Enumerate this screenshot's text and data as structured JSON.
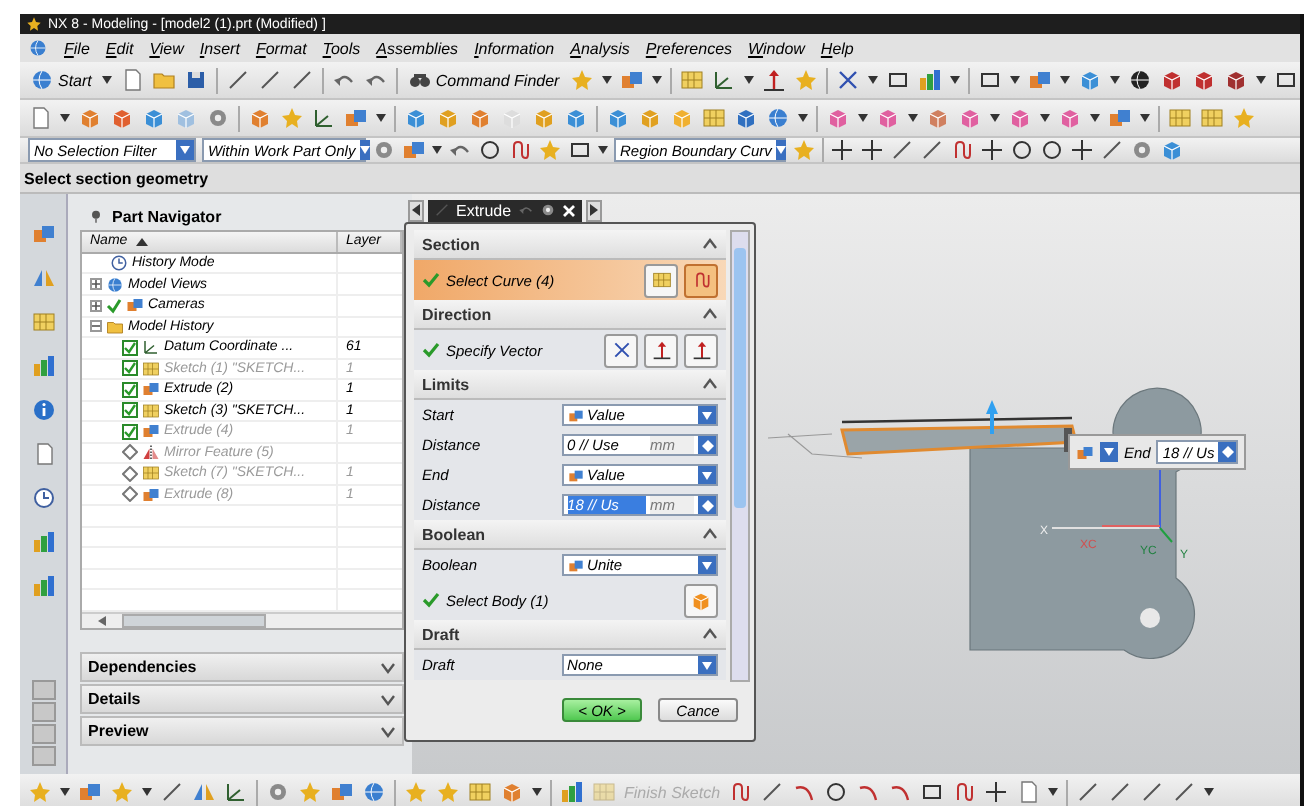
{
  "window": {
    "title": "NX 8 - Modeling - [model2 (1).prt (Modified) ]"
  },
  "menu": [
    "File",
    "Edit",
    "View",
    "Insert",
    "Format",
    "Tools",
    "Assemblies",
    "Information",
    "Analysis",
    "Preferences",
    "Window",
    "Help"
  ],
  "toolbar": {
    "start": "Start",
    "command_finder": "Command Finder"
  },
  "selection_bar": {
    "filters": [
      "No Selection Filter",
      "Within Work Part Only",
      "Region Boundary Curv"
    ]
  },
  "cue_line": "Select section geometry",
  "navigator": {
    "title": "Part Navigator",
    "columns": [
      "Name",
      "Layer"
    ],
    "tree": [
      {
        "label": "History Mode",
        "kind": "history",
        "checked": false
      },
      {
        "label": "Model Views",
        "kind": "views",
        "checked": false,
        "expanded": false
      },
      {
        "label": "Cameras",
        "kind": "cameras",
        "checked": true,
        "expanded": false
      },
      {
        "label": "Model History",
        "kind": "group",
        "checked": false,
        "expanded": true,
        "children": [
          {
            "label": "Datum Coordinate ...",
            "layer": "61",
            "kind": "datum",
            "checked": true,
            "dimmed": false
          },
          {
            "label": "Sketch (1) \"SKETCH...",
            "layer": "1",
            "kind": "sketch",
            "checked": true,
            "dimmed": true
          },
          {
            "label": "Extrude (2)",
            "layer": "1",
            "kind": "extrude",
            "checked": true,
            "dimmed": false
          },
          {
            "label": "Sketch (3) \"SKETCH...",
            "layer": "1",
            "kind": "sketch",
            "checked": true,
            "dimmed": false
          },
          {
            "label": "Extrude (4)",
            "layer": "1",
            "kind": "extrude",
            "checked": true,
            "dimmed": true
          },
          {
            "label": "Mirror Feature (5)",
            "kind": "mirror",
            "checked": false,
            "dimmed": true
          },
          {
            "label": "Sketch (7) \"SKETCH...",
            "layer": "1",
            "kind": "sketch",
            "checked": false,
            "dimmed": true
          },
          {
            "label": "Extrude (8)",
            "layer": "1",
            "kind": "extrude",
            "checked": false,
            "dimmed": true
          }
        ]
      }
    ],
    "panels": [
      {
        "title": "Dependencies",
        "expanded": false
      },
      {
        "title": "Details",
        "expanded": false
      },
      {
        "title": "Preview",
        "expanded": false
      }
    ]
  },
  "dialog": {
    "title": "Extrude",
    "sections": [
      {
        "title": "Section",
        "expanded": true,
        "rows": [
          {
            "kind": "select",
            "label": "Select Curve (4)",
            "done": true,
            "active": true
          }
        ]
      },
      {
        "title": "Direction",
        "expanded": true,
        "rows": [
          {
            "kind": "select",
            "label": "Specify Vector",
            "done": true,
            "active": false
          }
        ]
      },
      {
        "title": "Limits",
        "expanded": true,
        "rows": [
          {
            "kind": "iconselect",
            "label": "Start",
            "value": "Value"
          },
          {
            "kind": "distance",
            "label": "Distance",
            "value": "0 // Use",
            "unit": "mm",
            "selected": false
          },
          {
            "kind": "iconselect",
            "label": "End",
            "value": "Value"
          },
          {
            "kind": "distance",
            "label": "Distance",
            "value": "18 // Us",
            "unit": "mm",
            "selected": true
          }
        ]
      },
      {
        "title": "Boolean",
        "expanded": true,
        "rows": [
          {
            "kind": "iconselect",
            "label": "Boolean",
            "value": "Unite"
          },
          {
            "kind": "select",
            "label": "Select Body (1)",
            "done": true,
            "active": false
          }
        ]
      },
      {
        "title": "Draft",
        "expanded": true,
        "rows": [
          {
            "kind": "dropdown",
            "label": "Draft",
            "value": "None"
          }
        ]
      }
    ],
    "buttons": [
      {
        "label": "< OK >",
        "default": true
      },
      {
        "label": "Cance",
        "default": false
      }
    ]
  },
  "canvas": {
    "handle": {
      "label": "End",
      "value": "18 // Us"
    },
    "axis_labels": [
      "X",
      "XC",
      "YC",
      "Y"
    ]
  },
  "bottom_toolbar": {
    "finish_sketch": {
      "label": "Finish Sketch",
      "disabled": true
    }
  }
}
